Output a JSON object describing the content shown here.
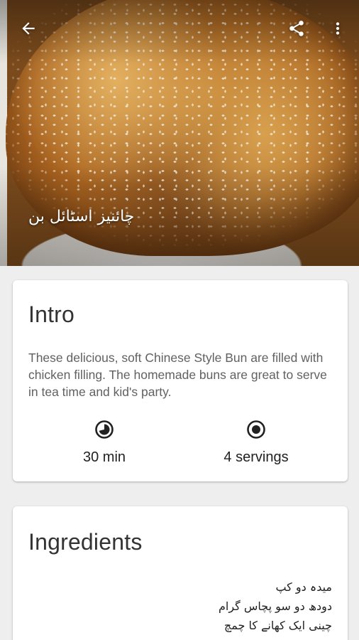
{
  "recipe": {
    "title": "چائنیز اسٹائل بن"
  },
  "toolbar": {
    "back_icon": "arrow-back-icon",
    "share_icon": "share-icon",
    "more_icon": "more-vert-icon"
  },
  "intro": {
    "heading": "Intro",
    "description": "These delicious, soft Chinese Style Bun are filled with chicken filling. The homemade buns are great to serve in tea time and kid's party.",
    "time": "30 min",
    "servings": "4 servings",
    "time_icon": "timer-icon",
    "servings_icon": "servings-icon"
  },
  "ingredients": {
    "heading": "Ingredients",
    "items": [
      "میدہ دو کپ",
      "دودھ دو سو پچاس گرام",
      "چینی ایک کھانے کا چمچ"
    ]
  },
  "colors": {
    "background": "#eeeeee",
    "card": "#ffffff",
    "title_text": "#333333",
    "body_text": "#616161"
  }
}
